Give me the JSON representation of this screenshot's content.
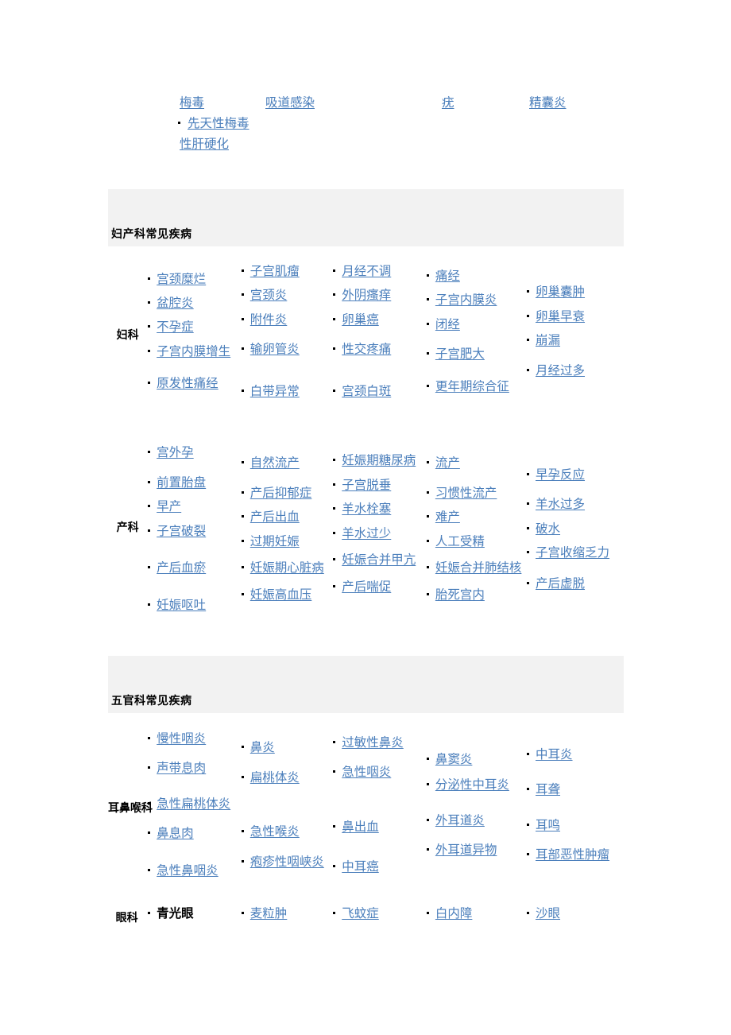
{
  "top_fragment": {
    "items": [
      {
        "text": "梅毒",
        "kind": "link"
      },
      {
        "text": "吸道感染",
        "kind": "link"
      },
      {
        "text": "疣",
        "kind": "link"
      },
      {
        "text": "精囊炎",
        "kind": "link"
      },
      {
        "text": "先天性梅毒",
        "kind": "link",
        "bullet": true
      },
      {
        "text": "性肝硬化",
        "kind": "link",
        "bullet": false
      }
    ]
  },
  "sections": [
    {
      "id": "obgyn",
      "title": "妇产科常见疾病",
      "rows": [
        {
          "label": "妇科",
          "columns": [
            [
              {
                "text": "宫颈糜烂",
                "kind": "link"
              },
              {
                "text": "盆腔炎",
                "kind": "link"
              },
              {
                "text": "不孕症",
                "kind": "link"
              },
              {
                "text": "子宫内膜增生",
                "kind": "link"
              },
              {
                "text": "原发性痛经",
                "kind": "link"
              }
            ],
            [
              {
                "text": "子宫肌瘤",
                "kind": "link"
              },
              {
                "text": "宫颈炎",
                "kind": "link"
              },
              {
                "text": "附件炎",
                "kind": "link"
              },
              {
                "text": "输卵管炎",
                "kind": "link"
              },
              {
                "text": "白带异常",
                "kind": "link"
              }
            ],
            [
              {
                "text": "月经不调",
                "kind": "link"
              },
              {
                "text": "外阴瘙痒",
                "kind": "link"
              },
              {
                "text": "卵巢癌",
                "kind": "link"
              },
              {
                "text": "性交疼痛",
                "kind": "link"
              },
              {
                "text": "宫颈白斑",
                "kind": "link"
              }
            ],
            [
              {
                "text": "痛经",
                "kind": "link"
              },
              {
                "text": "子宫内膜炎",
                "kind": "link"
              },
              {
                "text": "闭经",
                "kind": "link"
              },
              {
                "text": "子宫肥大",
                "kind": "link"
              },
              {
                "text": "更年期综合征",
                "kind": "link"
              }
            ],
            [
              {
                "text": "卵巢囊肿",
                "kind": "link"
              },
              {
                "text": "卵巢早衰",
                "kind": "link"
              },
              {
                "text": "崩漏",
                "kind": "link"
              },
              {
                "text": "月经过多",
                "kind": "link"
              }
            ]
          ]
        },
        {
          "label": "产科",
          "columns": [
            [
              {
                "text": "宫外孕",
                "kind": "link"
              },
              {
                "text": "前置胎盘",
                "kind": "link"
              },
              {
                "text": "早产",
                "kind": "link"
              },
              {
                "text": "子宫破裂",
                "kind": "link"
              },
              {
                "text": "产后血瘀",
                "kind": "link"
              },
              {
                "text": "妊娠呕吐",
                "kind": "link"
              }
            ],
            [
              {
                "text": "自然流产",
                "kind": "link"
              },
              {
                "text": "产后抑郁症",
                "kind": "link"
              },
              {
                "text": "产后出血",
                "kind": "link"
              },
              {
                "text": "过期妊娠",
                "kind": "link"
              },
              {
                "text": "妊娠期心脏病",
                "kind": "link"
              },
              {
                "text": "妊娠高血压",
                "kind": "link"
              }
            ],
            [
              {
                "text": "妊娠期糖尿病",
                "kind": "link"
              },
              {
                "text": "子宫脱垂",
                "kind": "link"
              },
              {
                "text": "羊水栓塞",
                "kind": "link"
              },
              {
                "text": "羊水过少",
                "kind": "link"
              },
              {
                "text": "妊娠合并甲亢",
                "kind": "link"
              },
              {
                "text": "产后喘促",
                "kind": "link"
              }
            ],
            [
              {
                "text": "流产",
                "kind": "link"
              },
              {
                "text": "习惯性流产",
                "kind": "link"
              },
              {
                "text": "难产",
                "kind": "link"
              },
              {
                "text": "人工受精",
                "kind": "link"
              },
              {
                "text": "妊娠合并肺结核",
                "kind": "link"
              },
              {
                "text": "胎死宫内",
                "kind": "link"
              }
            ],
            [
              {
                "text": "早孕反应",
                "kind": "link"
              },
              {
                "text": "羊水过多",
                "kind": "link"
              },
              {
                "text": "破水",
                "kind": "link"
              },
              {
                "text": "子宫收缩乏力",
                "kind": "link"
              },
              {
                "text": "产后虚脱",
                "kind": "link"
              }
            ]
          ]
        }
      ]
    },
    {
      "id": "ent-eye",
      "title": "五官科常见疾病",
      "rows": [
        {
          "label": "耳鼻喉科",
          "columns": [
            [
              {
                "text": "慢性咽炎",
                "kind": "link"
              },
              {
                "text": "声带息肉",
                "kind": "link"
              },
              {
                "text": "急性扁桃体炎",
                "kind": "link"
              },
              {
                "text": "鼻息肉",
                "kind": "link"
              },
              {
                "text": "急性鼻咽炎",
                "kind": "link"
              }
            ],
            [
              {
                "text": "鼻炎",
                "kind": "link"
              },
              {
                "text": "扁桃体炎",
                "kind": "link"
              },
              {
                "text": "急性喉炎",
                "kind": "link"
              },
              {
                "text": "疱疹性咽峡炎",
                "kind": "link"
              }
            ],
            [
              {
                "text": "过敏性鼻炎",
                "kind": "link"
              },
              {
                "text": "急性咽炎",
                "kind": "link"
              },
              {
                "text": "鼻出血",
                "kind": "link"
              },
              {
                "text": "中耳癌",
                "kind": "link"
              }
            ],
            [
              {
                "text": "鼻窦炎",
                "kind": "link"
              },
              {
                "text": "分泌性中耳炎",
                "kind": "link"
              },
              {
                "text": "外耳道炎",
                "kind": "link"
              },
              {
                "text": "外耳道异物",
                "kind": "link"
              }
            ],
            [
              {
                "text": "中耳炎",
                "kind": "link"
              },
              {
                "text": "耳聋",
                "kind": "link"
              },
              {
                "text": "耳鸣",
                "kind": "link"
              },
              {
                "text": "耳部恶性肿瘤",
                "kind": "link"
              }
            ]
          ]
        },
        {
          "label": "眼科",
          "columns": [
            [
              {
                "text": "青光眼",
                "kind": "plain"
              }
            ],
            [
              {
                "text": "麦粒肿",
                "kind": "link"
              }
            ],
            [
              {
                "text": "飞蚊症",
                "kind": "link"
              }
            ],
            [
              {
                "text": "白内障",
                "kind": "link"
              }
            ],
            [
              {
                "text": "沙眼",
                "kind": "link"
              }
            ]
          ]
        }
      ]
    }
  ],
  "colors": {
    "link": "#4a7ebb",
    "text": "#000000",
    "band": "#f2f2f2",
    "page": "#ffffff"
  }
}
